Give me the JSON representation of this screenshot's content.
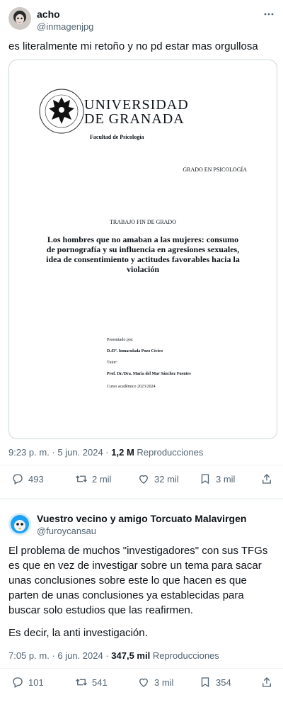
{
  "tweet1": {
    "user_name": "acho",
    "handle": "@inmagenjpg",
    "text": "es literalmente mi retoño y no pd estar mas orgullosa",
    "document": {
      "university_line1": "UNIVERSIDAD",
      "university_line2": "DE GRANADA",
      "faculty": "Facultad de Psicología",
      "degree": "GRADO EN PSICOLOGÍA",
      "work_type": "TRABAJO FIN DE GRADO",
      "title": "Los hombres que no amaban a las mujeres: consumo de pornografía y su influencia en agresiones sexuales, idea de consentimiento y actitudes favorables hacia la violación",
      "presented_by_label": "Presentado por:",
      "author": "D./Dª. Inmaculada Pozo Cívico",
      "tutor_label": "Tutor:",
      "tutor": "Prof. Dr./Dra. María del Mar Sánchez Fuentes",
      "course": "Curso académico 2023/2024"
    },
    "timestamp": "9:23 p. m. · 5 jun. 2024 ·",
    "views": "1,2 M",
    "views_label": "Reproducciones",
    "replies": "493",
    "retweets": "2 mil",
    "likes": "32 mil",
    "bookmarks": "3 mil"
  },
  "tweet2": {
    "user_name": "Vuestro vecino y amigo Torcuato Malavirgen",
    "handle": "@furoycansau",
    "text_p1": "El problema de muchos \"investigadores\" con sus TFGs es que en vez de investigar sobre un tema para sacar unas conclusiones sobre este lo que hacen es que parten de unas conclusiones ya establecidas para buscar solo estudios que las reafirmen.",
    "text_p2": "Es decir, la anti investigación.",
    "timestamp": "7:05 p. m. · 6 jun. 2024 ·",
    "views": "347,5 mil",
    "views_label": "Reproducciones",
    "replies": "101",
    "retweets": "541",
    "likes": "3 mil",
    "bookmarks": "354"
  },
  "icons": {
    "more": "more-icon",
    "reply": "reply-icon",
    "retweet": "retweet-icon",
    "like": "heart-icon",
    "bookmark": "bookmark-icon",
    "share": "share-icon"
  },
  "colors": {
    "text": "#0f1419",
    "secondary": "#536471",
    "border": "#cfd9de"
  }
}
